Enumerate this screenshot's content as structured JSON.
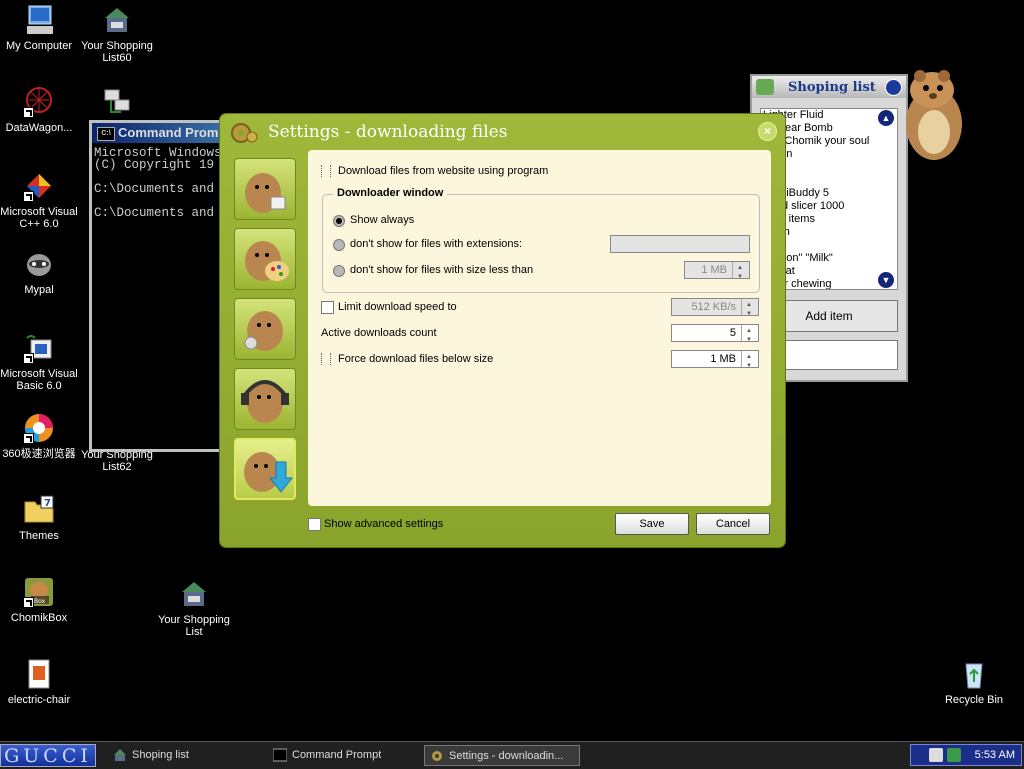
{
  "desktop": {
    "icons": [
      {
        "label": "My Computer"
      },
      {
        "label": "Your Shopping List60"
      },
      {
        "label": "DataWagon..."
      },
      {
        "label": "Microsoft Visual C++ 6.0"
      },
      {
        "label": "Mypal"
      },
      {
        "label": "Microsoft Visual Basic 6.0"
      },
      {
        "label": "360极速浏览器"
      },
      {
        "label": "Your Shopping List62"
      },
      {
        "label": "Themes"
      },
      {
        "label": "ChomikBox"
      },
      {
        "label": "Your Shopping List"
      },
      {
        "label": "electric-chair"
      },
      {
        "label": "Recycle Bin"
      }
    ]
  },
  "cmd": {
    "title": "Command Prompt",
    "lines": "Microsoft Windows\n(C) Copyright 19\n\nC:\\Documents and\n\nC:\\Documents and"
  },
  "shopping": {
    "title": "Shoping list",
    "items": [
      "Lighter Fluid",
      "Nuclear Bomb",
      "Sell Chomik your soul",
      "Onion",
      "s",
      "s",
      "CraziBuddy 5",
      "Food slicer 1000",
      "Real items",
      "Teeth",
      "e",
      "Demon\" \"Milk\"",
      "Wheat",
      "Floor chewing"
    ],
    "add_label": "Add item"
  },
  "settings": {
    "title": "Settings - downloading files",
    "download_using_program": "Download files from website using program",
    "group_title": "Downloader window",
    "radio_show_always": "Show always",
    "radio_extensions": "don't show for files with extensions:",
    "radio_size": "don't show for files with size less than",
    "size_value": "1 MB",
    "limit_speed": "Limit download speed to",
    "speed_value": "512 KB/s",
    "active_downloads": "Active downloads count",
    "active_value": "5",
    "force_download": "Force download files below size",
    "force_value": "1 MB",
    "advanced": "Show advanced settings",
    "save": "Save",
    "cancel": "Cancel"
  },
  "taskbar": {
    "start": "GUCCI",
    "tasks": [
      "Shoping list",
      "Command Prompt",
      "Settings - downloadin..."
    ],
    "clock": "5:53 AM"
  },
  "colors": {
    "dialog_green": "#9fb83a",
    "panel_bg": "#fbf6dc",
    "tray_blue": "#1a2e8a"
  }
}
